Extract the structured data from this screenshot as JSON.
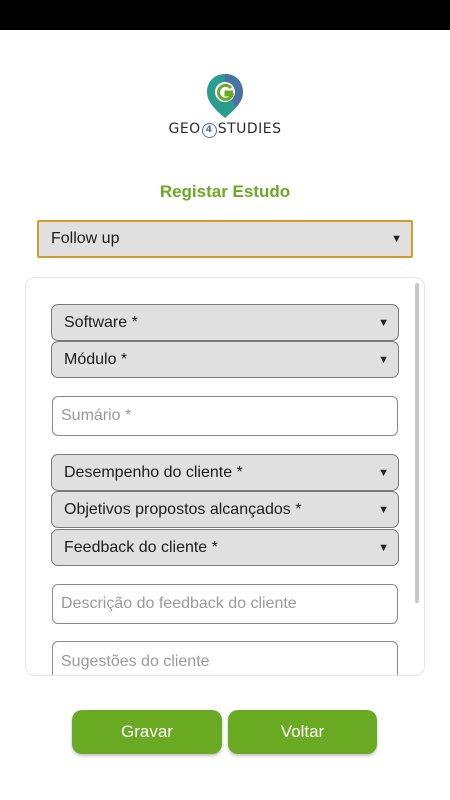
{
  "app": {
    "logo_text_left": "GEO",
    "logo_text_number": "4",
    "logo_text_right": "STUDIES",
    "title": "Registar Estudo"
  },
  "colors": {
    "accent_green": "#6aaa22",
    "focus_border": "#d69a2a",
    "logo_teal": "#2a9d8f",
    "logo_blue": "#4a6fa5"
  },
  "icons": {
    "dropdown": "triangle-down"
  },
  "study_type": {
    "selected": "Follow up"
  },
  "form": {
    "software": "Software *",
    "modulo": "Módulo *",
    "sumario_placeholder": "Sumário *",
    "desempenho": "Desempenho do cliente *",
    "objetivos": "Objetivos propostos alcançados *",
    "feedback": "Feedback do cliente *",
    "descricao_placeholder": "Descrição do feedback do cliente",
    "sugestoes_placeholder": "Sugestões do cliente"
  },
  "buttons": {
    "save": "Gravar",
    "back": "Voltar"
  }
}
